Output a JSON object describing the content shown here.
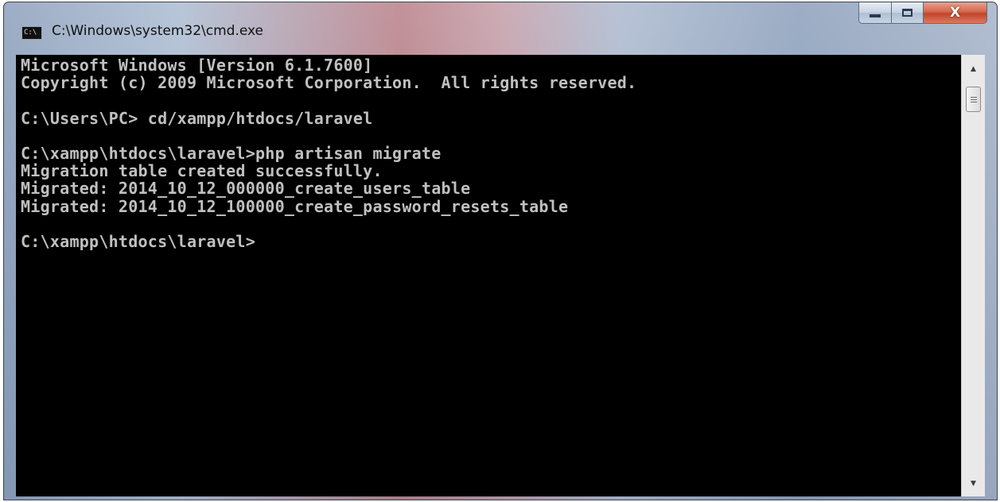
{
  "window": {
    "title": "C:\\Windows\\system32\\cmd.exe",
    "icon": "cmd-icon",
    "icon_text": "C:\\",
    "controls": {
      "minimize": "minimize-icon",
      "maximize": "maximize-icon",
      "close": "close-icon",
      "close_glyph": "X"
    }
  },
  "console": {
    "lines": [
      "Microsoft Windows [Version 6.1.7600]",
      "Copyright (c) 2009 Microsoft Corporation.  All rights reserved.",
      "",
      "C:\\Users\\PC> cd/xampp/htdocs/laravel",
      "",
      "C:\\xampp\\htdocs\\laravel>php artisan migrate",
      "Migration table created successfully.",
      "Migrated: 2014_10_12_000000_create_users_table",
      "Migrated: 2014_10_12_100000_create_password_resets_table",
      "",
      "C:\\xampp\\htdocs\\laravel>"
    ],
    "text_color": "#c0c0c0",
    "background": "#000000"
  },
  "scrollbar": {
    "up_arrow": "▲",
    "down_arrow": "▼"
  }
}
